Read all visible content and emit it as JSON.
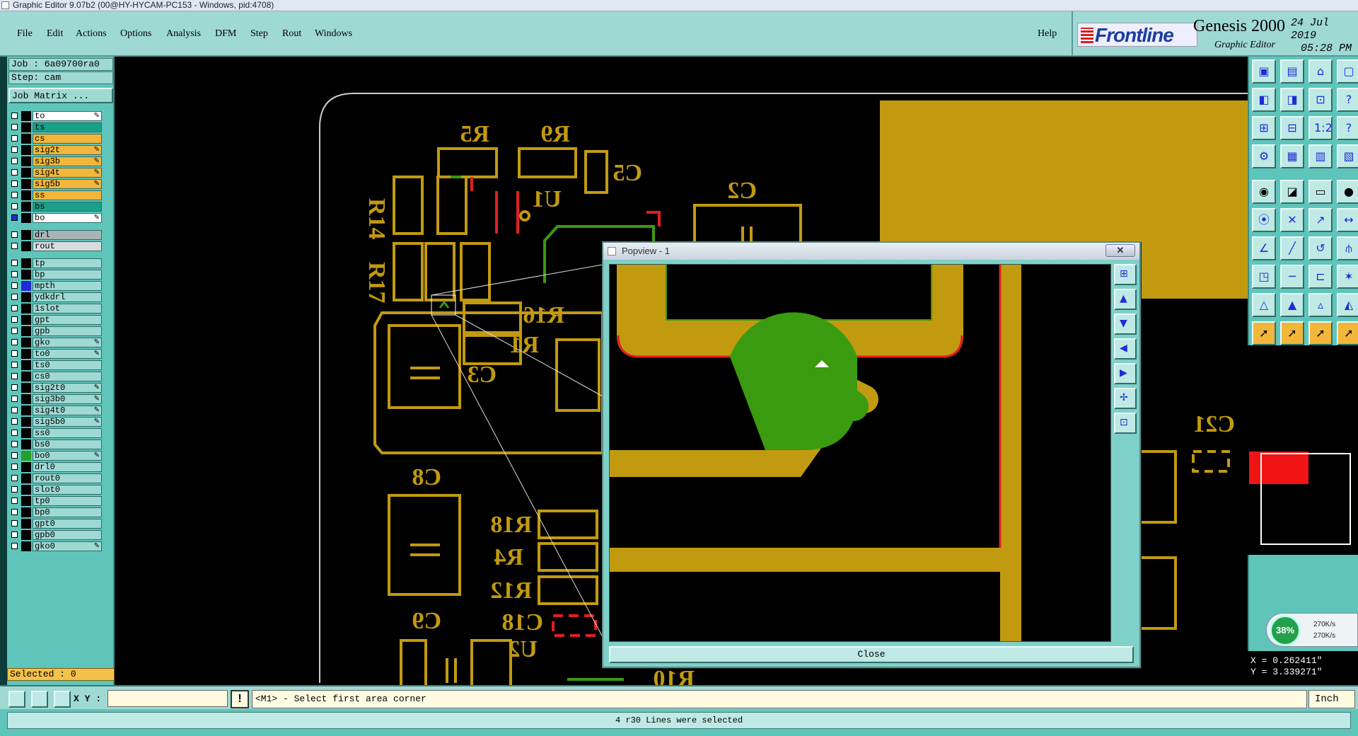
{
  "window": {
    "title": "Graphic Editor 9.07b2 (00@HY-HYCAM-PC153 - Windows, pid:4708)"
  },
  "menu": {
    "items": [
      "File",
      "Edit",
      "Actions",
      "Options",
      "Analysis",
      "DFM",
      "Step",
      "Rout",
      "Windows"
    ],
    "help": "Help"
  },
  "brand": {
    "logo": "Frontline",
    "product": "Genesis 2000",
    "subtitle": "Graphic Editor",
    "date": "24 Jul 2019",
    "time": "05:28 PM"
  },
  "left_panel": {
    "job": "Job : 6a09700ra0",
    "step": "Step: cam",
    "job_matrix": "Job Matrix ...",
    "layers_board": [
      {
        "name": "to",
        "bg": "#ffffff",
        "swatch": "#000000",
        "mark": true
      },
      {
        "name": "ts",
        "bg": "#1aa088",
        "swatch": "#000000",
        "mark": false
      },
      {
        "name": "cs",
        "bg": "#f2b63a",
        "swatch": "#000000",
        "mark": false
      },
      {
        "name": "sig2t",
        "bg": "#f2b63a",
        "swatch": "#000000",
        "mark": true
      },
      {
        "name": "sig3b",
        "bg": "#f2b63a",
        "swatch": "#000000",
        "mark": true
      },
      {
        "name": "sig4t",
        "bg": "#f2b63a",
        "swatch": "#000000",
        "mark": true
      },
      {
        "name": "sig5b",
        "bg": "#f2b63a",
        "swatch": "#000000",
        "mark": true
      },
      {
        "name": "ss",
        "bg": "#f2b63a",
        "swatch": "#000000",
        "mark": false
      },
      {
        "name": "bs",
        "bg": "#1aa088",
        "swatch": "#000000",
        "mark": false
      },
      {
        "name": "bo",
        "bg": "#ffffff",
        "swatch": "#000000",
        "mark": true,
        "checked": true
      }
    ],
    "layers_drill": [
      {
        "name": "drl",
        "bg": "#a8b4b6",
        "swatch": "#000000",
        "mark": false
      },
      {
        "name": "rout",
        "bg": "#d8dcdc",
        "swatch": "#000000",
        "mark": false
      }
    ],
    "layers_misc": [
      {
        "name": "tp",
        "bg": "#9fd9d4",
        "swatch": "#000000",
        "mark": false
      },
      {
        "name": "bp",
        "bg": "#9fd9d4",
        "swatch": "#000000",
        "mark": false
      },
      {
        "name": "mpth",
        "bg": "#9fd9d4",
        "swatch": "#1e2bd8",
        "mark": false
      },
      {
        "name": "ydkdrl",
        "bg": "#9fd9d4",
        "swatch": "#000000",
        "mark": false
      },
      {
        "name": "1slot",
        "bg": "#9fd9d4",
        "swatch": "#000000",
        "mark": false
      },
      {
        "name": "gpt",
        "bg": "#9fd9d4",
        "swatch": "#000000",
        "mark": false
      },
      {
        "name": "gpb",
        "bg": "#9fd9d4",
        "swatch": "#000000",
        "mark": false
      },
      {
        "name": "gko",
        "bg": "#9fd9d4",
        "swatch": "#000000",
        "mark": true
      },
      {
        "name": "to0",
        "bg": "#9fd9d4",
        "swatch": "#000000",
        "mark": true
      },
      {
        "name": "ts0",
        "bg": "#9fd9d4",
        "swatch": "#000000",
        "mark": false
      },
      {
        "name": "cs0",
        "bg": "#9fd9d4",
        "swatch": "#000000",
        "mark": false
      },
      {
        "name": "sig2t0",
        "bg": "#9fd9d4",
        "swatch": "#000000",
        "mark": true
      },
      {
        "name": "sig3b0",
        "bg": "#9fd9d4",
        "swatch": "#000000",
        "mark": true
      },
      {
        "name": "sig4t0",
        "bg": "#9fd9d4",
        "swatch": "#000000",
        "mark": true
      },
      {
        "name": "sig5b0",
        "bg": "#9fd9d4",
        "swatch": "#000000",
        "mark": true
      },
      {
        "name": "ss0",
        "bg": "#9fd9d4",
        "swatch": "#000000",
        "mark": false
      },
      {
        "name": "bs0",
        "bg": "#9fd9d4",
        "swatch": "#000000",
        "mark": false
      },
      {
        "name": "bo0",
        "bg": "#9fd9d4",
        "swatch": "#22a02a",
        "mark": true
      },
      {
        "name": "drl0",
        "bg": "#9fd9d4",
        "swatch": "#000000",
        "mark": false
      },
      {
        "name": "rout0",
        "bg": "#9fd9d4",
        "swatch": "#000000",
        "mark": false
      },
      {
        "name": "slot0",
        "bg": "#9fd9d4",
        "swatch": "#000000",
        "mark": false
      },
      {
        "name": "tp0",
        "bg": "#9fd9d4",
        "swatch": "#000000",
        "mark": false
      },
      {
        "name": "bp0",
        "bg": "#9fd9d4",
        "swatch": "#000000",
        "mark": false
      },
      {
        "name": "gpt0",
        "bg": "#9fd9d4",
        "swatch": "#000000",
        "mark": false
      },
      {
        "name": "gpb0",
        "bg": "#9fd9d4",
        "swatch": "#000000",
        "mark": false
      },
      {
        "name": "gko0",
        "bg": "#9fd9d4",
        "swatch": "#000000",
        "mark": true
      }
    ],
    "selected": "Selected : 0"
  },
  "canvas": {
    "designators": [
      "R5",
      "R9",
      "C5",
      "U1",
      "C2",
      "R14",
      "R17",
      "R16",
      "R1",
      "C3",
      "C8",
      "R18",
      "R4",
      "R12",
      "C18",
      "C9",
      "U2",
      "R10",
      "C21"
    ]
  },
  "popview": {
    "title": "Popview - 1",
    "close_x": "✕",
    "close_label": "Close"
  },
  "bottom": {
    "xy_label": "X Y :",
    "xy_value": "",
    "excl": "!",
    "prompt": "<M1> - Select first area corner",
    "unit": "Inch",
    "status": "4 r30 Lines were selected"
  },
  "coords": {
    "x": "X = 0.262411\"",
    "y": "Y = 3.339271\""
  },
  "network": {
    "percent": "38%",
    "up": "270K/s",
    "down": "270K/s"
  },
  "colors": {
    "pcb_yellow": "#c29a10",
    "pcb_green": "#3a9a10",
    "pcb_red": "#e02020",
    "panel_teal": "#5fc5bb",
    "highlight_orange": "#f2b63a"
  }
}
